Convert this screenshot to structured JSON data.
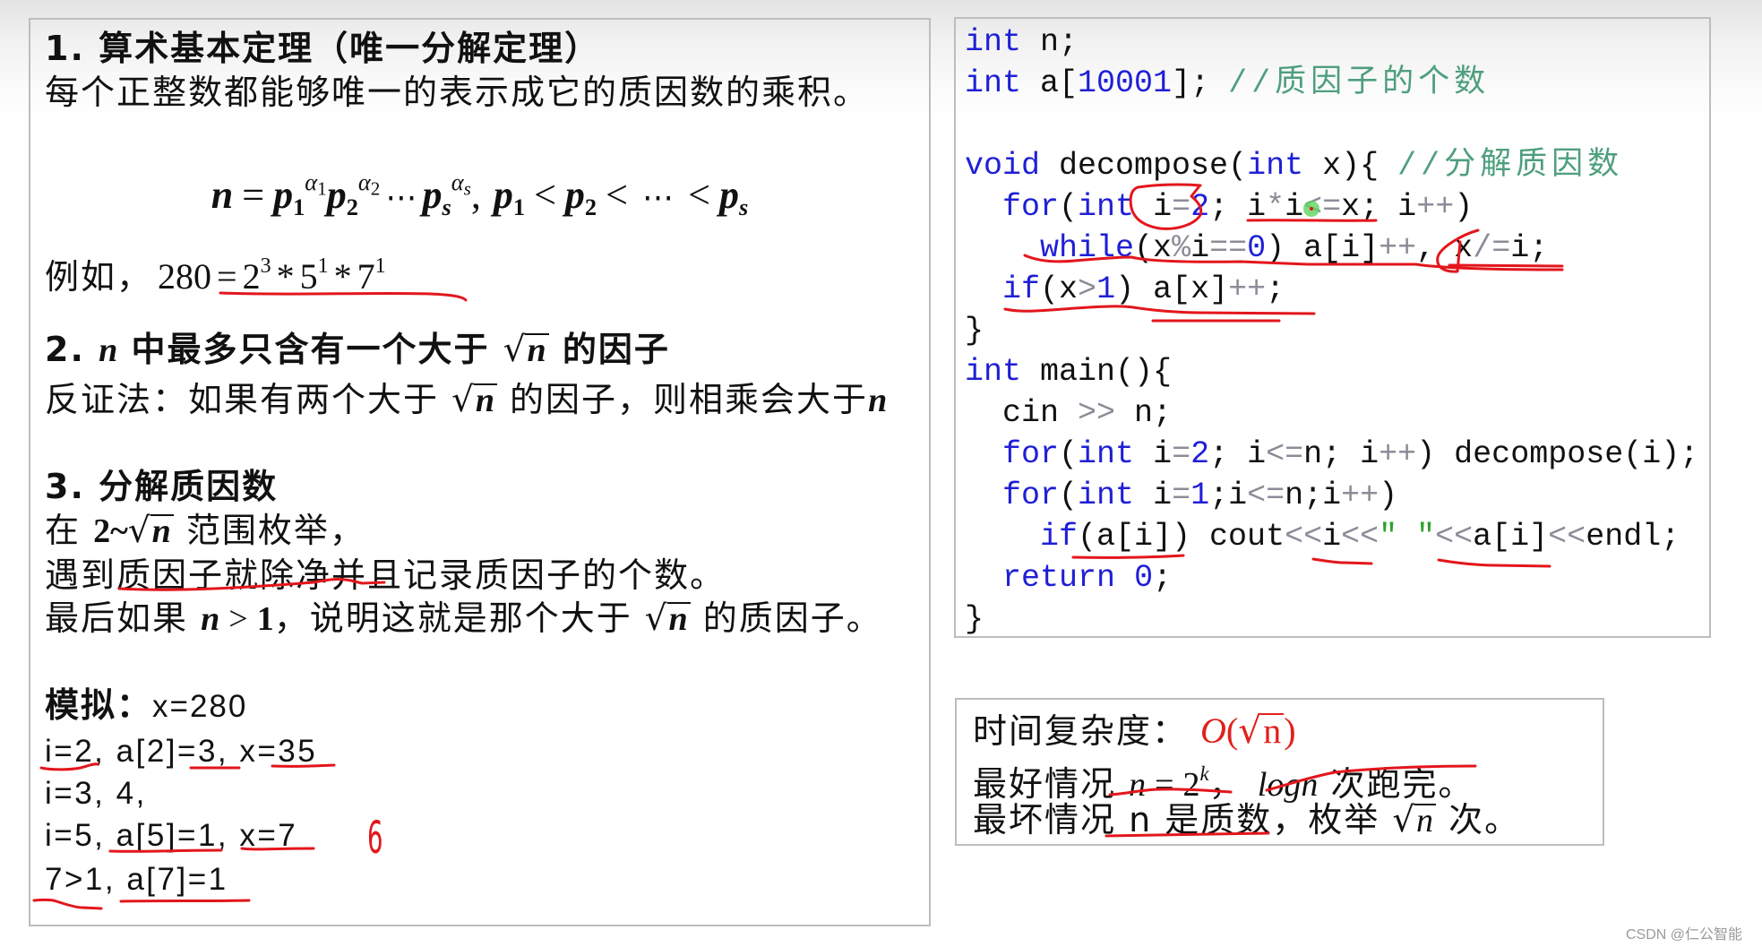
{
  "theorem_panel": {
    "section1": {
      "title": "1. 算术基本定理（唯一分解定理）",
      "statement": "每个正整数都能够唯一的表示成它的质因数的乘积。",
      "formula": {
        "lhs": "n",
        "equals": "=",
        "factors": [
          {
            "base": "p",
            "index": "1",
            "exponent": "α",
            "exponent_index": "1"
          },
          {
            "base": "p",
            "index": "2",
            "exponent": "α",
            "exponent_index": "2"
          },
          {
            "base": "p",
            "index": "s",
            "exponent": "α",
            "exponent_index": "s"
          }
        ],
        "dots": "⋯",
        "comma": ",",
        "ordering": [
          {
            "base": "p",
            "index": "1"
          },
          {
            "base": "p",
            "index": "2"
          },
          {
            "base": "p",
            "index": "s"
          }
        ],
        "less_than": "<"
      },
      "example": {
        "label": "例如，",
        "number": "280",
        "equals": "=",
        "times": "*",
        "factors": [
          {
            "base": "2",
            "exponent": "3"
          },
          {
            "base": "5",
            "exponent": "1"
          },
          {
            "base": "7",
            "exponent": "1"
          }
        ]
      }
    },
    "section2": {
      "number": "2.",
      "var": "n",
      "title_mid": "中最多只含有一个大于",
      "title_radicand": "n",
      "title_suffix": "的因子",
      "proof_prefix": "反证法：如果有两个大于",
      "proof_radicand": "n",
      "proof_mid": "的因子，则相乘会大于",
      "proof_var": "n"
    },
    "section3": {
      "title": "3. 分解质因数",
      "range_prefix": "在",
      "range_start": "2~",
      "range_radicand": "n",
      "range_suffix": "范围枚举，",
      "divide_rule": "遇到质因子就除净并且记录质因子的个数。",
      "remainder_prefix": "最后如果",
      "remainder_var": "n",
      "remainder_op": ">",
      "remainder_value": "1",
      "remainder_mid": "，说明这就是那个大于",
      "remainder_radicand": "n",
      "remainder_suffix": "的质因子。"
    },
    "simulation": {
      "label": "模拟：",
      "initial": "x=280",
      "steps": [
        "i=2, a[2]=3, x=35",
        "i=3, 4,",
        "i=5, a[5]=1, x=7",
        "7>1, a[7]=1"
      ]
    }
  },
  "code_panel": {
    "lines": [
      [
        [
          "keyword",
          "int"
        ],
        [
          "plain",
          " n;"
        ]
      ],
      [
        [
          "keyword",
          "int"
        ],
        [
          "plain",
          " a["
        ],
        [
          "number",
          "10001"
        ],
        [
          "plain",
          "]; "
        ],
        [
          "comment",
          "//质因子的个数"
        ]
      ],
      [],
      [
        [
          "keyword",
          "void"
        ],
        [
          "plain",
          " decompose("
        ],
        [
          "keyword",
          "int"
        ],
        [
          "plain",
          " x){ "
        ],
        [
          "comment",
          "//分解质因数"
        ]
      ],
      [
        [
          "plain",
          "  "
        ],
        [
          "keyword",
          "for"
        ],
        [
          "plain",
          "("
        ],
        [
          "keyword",
          "int"
        ],
        [
          "plain",
          " i"
        ],
        [
          "operator",
          "="
        ],
        [
          "number",
          "2"
        ],
        [
          "plain",
          "; i"
        ],
        [
          "operator",
          "*"
        ],
        [
          "plain",
          "i"
        ],
        [
          "operator",
          "<="
        ],
        [
          "plain",
          "x; i"
        ],
        [
          "operator",
          "++"
        ],
        [
          "plain",
          ")"
        ]
      ],
      [
        [
          "plain",
          "    "
        ],
        [
          "keyword",
          "while"
        ],
        [
          "plain",
          "(x"
        ],
        [
          "operator",
          "%"
        ],
        [
          "plain",
          "i"
        ],
        [
          "operator",
          "=="
        ],
        [
          "number",
          "0"
        ],
        [
          "plain",
          ") a[i]"
        ],
        [
          "operator",
          "++"
        ],
        [
          "plain",
          ", x"
        ],
        [
          "operator",
          "/="
        ],
        [
          "plain",
          "i;"
        ]
      ],
      [
        [
          "plain",
          "  "
        ],
        [
          "keyword",
          "if"
        ],
        [
          "plain",
          "(x"
        ],
        [
          "operator",
          ">"
        ],
        [
          "number",
          "1"
        ],
        [
          "plain",
          ") a[x]"
        ],
        [
          "operator",
          "++"
        ],
        [
          "plain",
          ";"
        ]
      ],
      [
        [
          "plain",
          "}"
        ]
      ],
      [
        [
          "keyword",
          "int"
        ],
        [
          "plain",
          " main(){"
        ]
      ],
      [
        [
          "plain",
          "  cin "
        ],
        [
          "operator",
          ">>"
        ],
        [
          "plain",
          " n;"
        ]
      ],
      [
        [
          "plain",
          "  "
        ],
        [
          "keyword",
          "for"
        ],
        [
          "plain",
          "("
        ],
        [
          "keyword",
          "int"
        ],
        [
          "plain",
          " i"
        ],
        [
          "operator",
          "="
        ],
        [
          "number",
          "2"
        ],
        [
          "plain",
          "; i"
        ],
        [
          "operator",
          "<="
        ],
        [
          "plain",
          "n; i"
        ],
        [
          "operator",
          "++"
        ],
        [
          "plain",
          ") decompose(i);"
        ]
      ],
      [
        [
          "plain",
          "  "
        ],
        [
          "keyword",
          "for"
        ],
        [
          "plain",
          "("
        ],
        [
          "keyword",
          "int"
        ],
        [
          "plain",
          " i"
        ],
        [
          "operator",
          "="
        ],
        [
          "number",
          "1"
        ],
        [
          "plain",
          ";i"
        ],
        [
          "operator",
          "<="
        ],
        [
          "plain",
          "n;i"
        ],
        [
          "operator",
          "++"
        ],
        [
          "plain",
          ")"
        ]
      ],
      [
        [
          "plain",
          "    "
        ],
        [
          "keyword",
          "if"
        ],
        [
          "plain",
          "(a[i]) cout"
        ],
        [
          "operator",
          "<<"
        ],
        [
          "plain",
          "i"
        ],
        [
          "operator",
          "<<"
        ],
        [
          "string",
          "\" \""
        ],
        [
          "operator",
          "<<"
        ],
        [
          "plain",
          "a[i]"
        ],
        [
          "operator",
          "<<"
        ],
        [
          "plain",
          "endl;"
        ]
      ],
      [
        [
          "plain",
          "  "
        ],
        [
          "keyword",
          "return"
        ],
        [
          "plain",
          " "
        ],
        [
          "number",
          "0"
        ],
        [
          "plain",
          ";"
        ]
      ],
      [
        [
          "plain",
          "}"
        ]
      ]
    ]
  },
  "complexity_panel": {
    "label": "时间复杂度：",
    "big_o": {
      "func": "O",
      "open": "(",
      "radicand": "n",
      "close": ")"
    },
    "best_case": {
      "label": "最好情况",
      "var": "n",
      "equals": "=",
      "base": "2",
      "exponent": "k",
      "comma": "，",
      "log": "logn",
      "suffix": "次跑完。"
    },
    "worst_case": {
      "label": "最坏情况 n 是质数，枚举",
      "radicand": "n",
      "suffix": "次。"
    }
  },
  "annotations": {
    "handwritten_note": "6"
  },
  "symbols": {
    "sqrt": "√"
  },
  "watermark": "CSDN @仁公智能",
  "colors": {
    "keyword": "#1f1fd6",
    "number": "#1f1fd6",
    "operator": "#8c8c99",
    "comment": "#4e9f7c",
    "string": "#2ea12e",
    "plain": "#111111",
    "annotation_red": "#e3161c",
    "highlight_green": "#5fd35f",
    "big_o_red": "#e0201c",
    "panel_border": "#bdbdbd"
  }
}
